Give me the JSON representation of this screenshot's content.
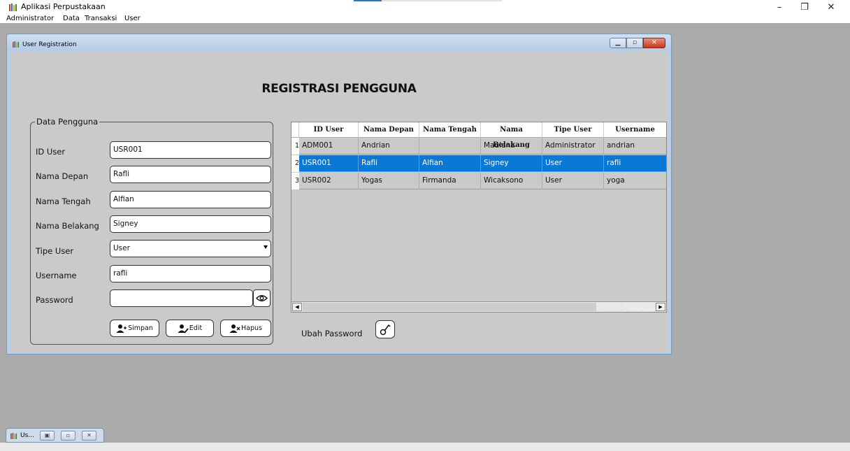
{
  "window": {
    "title": "Aplikasi Perpustakaan",
    "minimize": "–",
    "restore": "❐",
    "close": "✕",
    "progress": 0.19
  },
  "menu": [
    "Administrator",
    "Data",
    "Transaksi",
    "User"
  ],
  "frame": {
    "title": "User Registration",
    "minimized_title": "Us..."
  },
  "form": {
    "heading": "REGISTRASI PENGGUNA",
    "group_title": "Data Pengguna",
    "labels": {
      "id_user": "ID User",
      "nama_depan": "Nama Depan",
      "nama_tengah": "Nama Tengah",
      "nama_belakang": "Nama Belakang",
      "tipe_user": "Tipe User",
      "username": "Username",
      "password": "Password"
    },
    "values": {
      "id_user": "USR001",
      "nama_depan": "Rafli",
      "nama_tengah": "Alfian",
      "nama_belakang": "Signey",
      "tipe_user": "User",
      "username": "rafli",
      "password": ""
    },
    "buttons": {
      "simpan": "Simpan",
      "edit": "Edit",
      "hapus": "Hapus"
    },
    "ubah_password": "Ubah Password"
  },
  "table": {
    "columns": [
      "ID User",
      "Nama Depan",
      "Nama Tengah",
      "Nama Belakang",
      "Tipe User",
      "Username"
    ],
    "rows": [
      {
        "num": "1",
        "cells": [
          "ADM001",
          "Andrian",
          "",
          "Maulana",
          "Administrator",
          "andrian"
        ]
      },
      {
        "num": "2",
        "cells": [
          "USR001",
          "Rafli",
          "Alfian",
          "Signey",
          "User",
          "rafli"
        ]
      },
      {
        "num": "3",
        "cells": [
          "USR002",
          "Yogas",
          "Firmanda",
          "Wicaksono",
          "User",
          "yoga"
        ]
      }
    ],
    "selected_row": 1
  },
  "colors": {
    "selection": "#0a78d7",
    "panel": "#cacaca",
    "desktop": "#ababab",
    "frame_border": "#7d9ab8"
  }
}
